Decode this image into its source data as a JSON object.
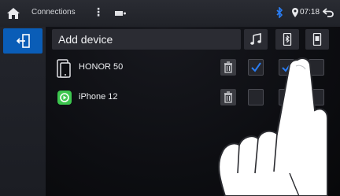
{
  "status_bar": {
    "title": "Connections",
    "menu_glyph": "⋮",
    "time": "07:18",
    "icons": [
      "home-icon",
      "menu-dots-icon",
      "battery-icon",
      "bluetooth-icon",
      "location-icon",
      "back-icon"
    ]
  },
  "sidebar": {
    "items": [
      {
        "icon": "add-device-icon",
        "active": true
      }
    ]
  },
  "header": {
    "title": "Add device",
    "columns": [
      {
        "icon": "music-icon"
      },
      {
        "icon": "phone-bluetooth-icon"
      },
      {
        "icon": "phone-mirror-icon"
      }
    ]
  },
  "devices": [
    {
      "name": "HONOR 50",
      "icon": "phone-icon",
      "media": true,
      "phone": true,
      "mirror": false
    },
    {
      "name": "iPhone 12",
      "icon": "carplay-icon",
      "media": false,
      "phone": false,
      "mirror": false
    }
  ],
  "colors": {
    "accent": "#0a5db7",
    "check": "#2a7df3",
    "carplay_green": "#3cc64e"
  }
}
